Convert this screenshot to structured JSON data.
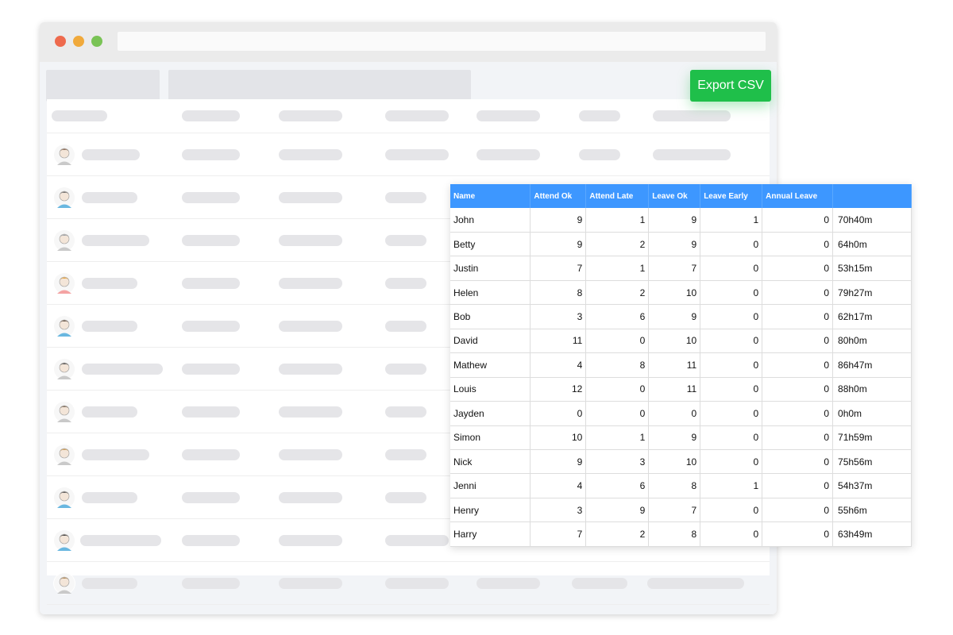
{
  "toolbar": {
    "export_label": "Export CSV"
  },
  "colors": {
    "accent_green": "#1fbf4a",
    "table_header": "#3d97ff"
  },
  "report": {
    "headers": [
      "Name",
      "Attend Ok",
      "Attend Late",
      "Leave Ok",
      "Leave Early",
      "Annual Leave",
      ""
    ],
    "rows": [
      [
        "John",
        "9",
        "1",
        "9",
        "1",
        "0",
        "70h40m"
      ],
      [
        "Betty",
        "9",
        "2",
        "9",
        "0",
        "0",
        "64h0m"
      ],
      [
        "Justin",
        "7",
        "1",
        "7",
        "0",
        "0",
        "53h15m"
      ],
      [
        "Helen",
        "8",
        "2",
        "10",
        "0",
        "0",
        "79h27m"
      ],
      [
        "Bob",
        "3",
        "6",
        "9",
        "0",
        "0",
        "62h17m"
      ],
      [
        "David",
        "11",
        "0",
        "10",
        "0",
        "0",
        "80h0m"
      ],
      [
        "Mathew",
        "4",
        "8",
        "11",
        "0",
        "0",
        "86h47m"
      ],
      [
        "Louis",
        "12",
        "0",
        "11",
        "0",
        "0",
        "88h0m"
      ],
      [
        "Jayden",
        "0",
        "0",
        "0",
        "0",
        "0",
        "0h0m"
      ],
      [
        "Simon",
        "10",
        "1",
        "9",
        "0",
        "0",
        "71h59m"
      ],
      [
        "Nick",
        "9",
        "3",
        "10",
        "0",
        "0",
        "75h56m"
      ],
      [
        "Jenni",
        "4",
        "6",
        "8",
        "1",
        "0",
        "54h37m"
      ],
      [
        "Henry",
        "3",
        "9",
        "7",
        "0",
        "0",
        "55h6m"
      ],
      [
        "Harry",
        "7",
        "2",
        "8",
        "0",
        "0",
        "63h49m"
      ]
    ]
  },
  "avatars": [
    "person-avatar",
    "person-avatar",
    "person-avatar",
    "person-avatar",
    "person-avatar",
    "person-avatar",
    "person-avatar",
    "person-avatar",
    "person-avatar",
    "person-avatar",
    "person-avatar"
  ]
}
